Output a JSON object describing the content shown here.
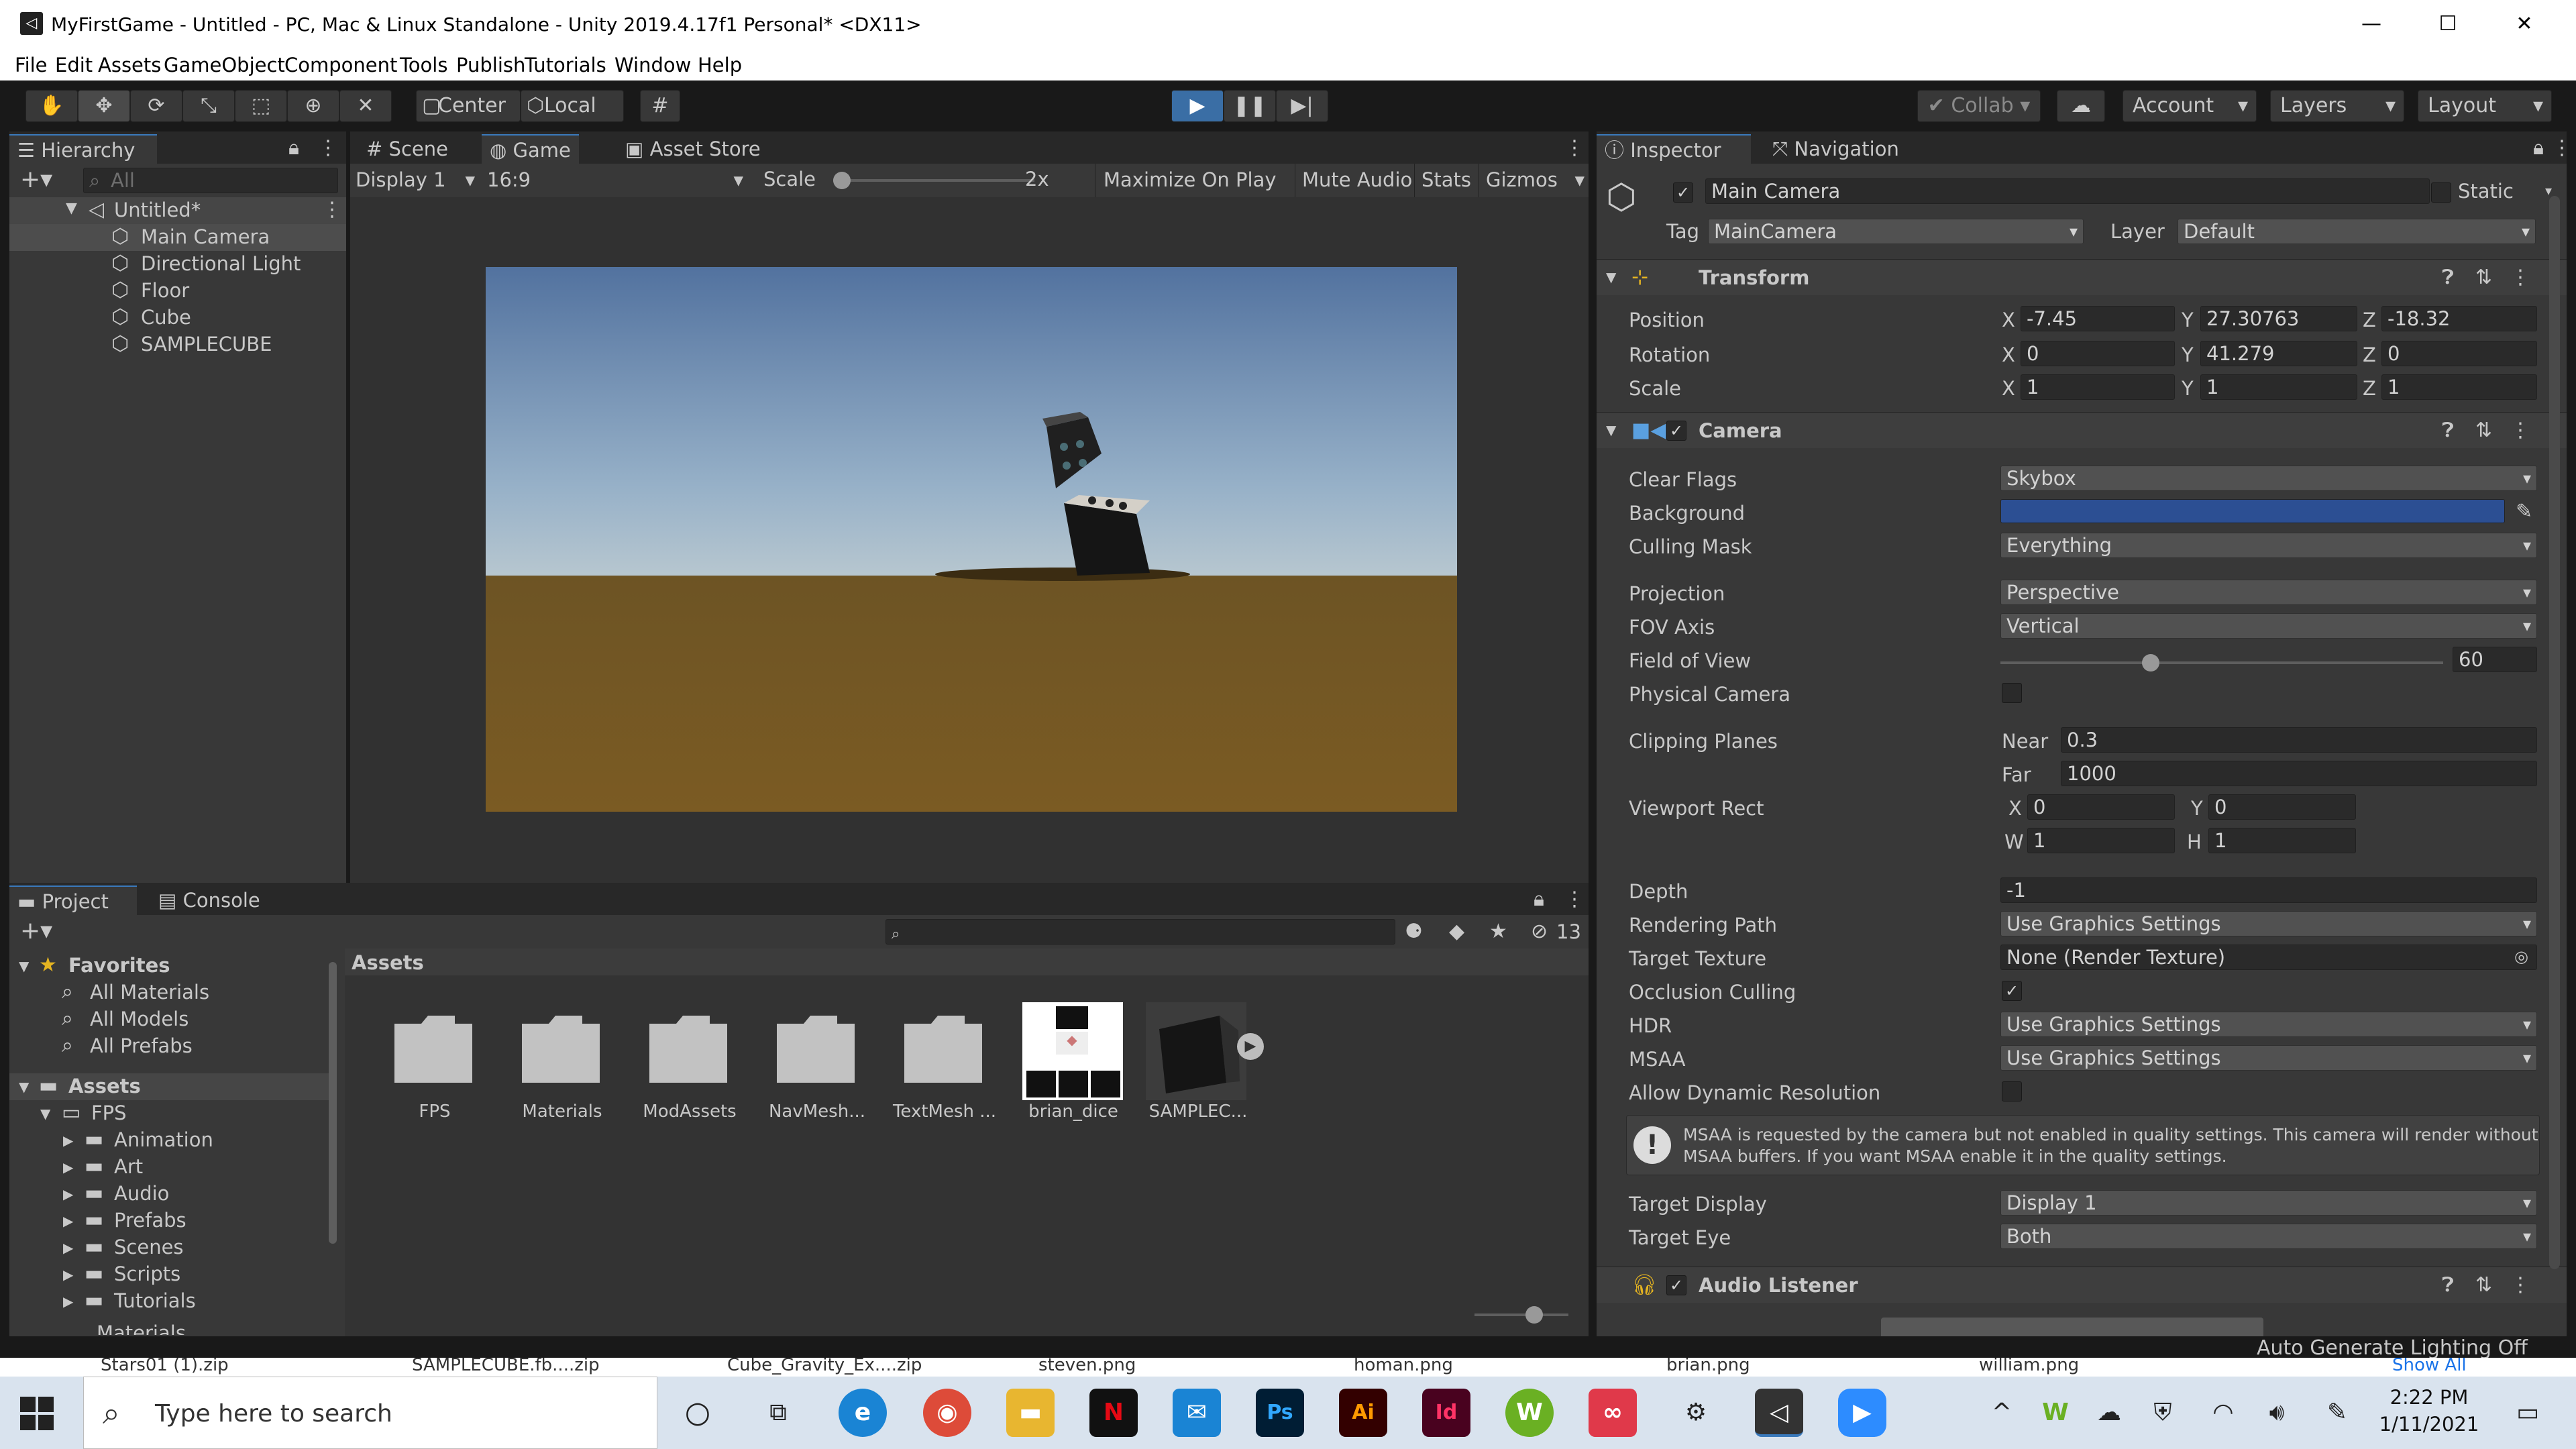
{
  "window": {
    "title": "MyFirstGame - Untitled - PC, Mac & Linux Standalone - Unity 2019.4.17f1 Personal* <DX11>"
  },
  "menu": [
    "File",
    "Edit",
    "Assets",
    "GameObject",
    "Component",
    "Tools",
    "Publish",
    "Tutorials",
    "Window",
    "Help"
  ],
  "toolbar": {
    "pivot": "Center",
    "space": "Local",
    "collab": "Collab",
    "account": "Account",
    "layers": "Layers",
    "layout": "Layout"
  },
  "hierarchy": {
    "tab": "Hierarchy",
    "search_placeholder": "All",
    "scene": "Untitled*",
    "items": [
      "Main Camera",
      "Directional Light",
      "Floor",
      "Cube",
      "SAMPLECUBE"
    ]
  },
  "center_tabs": {
    "scene": "Scene",
    "game": "Game",
    "store": "Asset Store"
  },
  "game_toolbar": {
    "display": "Display 1",
    "aspect": "16:9",
    "scale_label": "Scale",
    "scale_value": "2x",
    "scale_level": 0.0,
    "maximize": "Maximize On Play",
    "mute": "Mute Audio",
    "stats": "Stats",
    "gizmos": "Gizmos"
  },
  "project": {
    "tabs": {
      "project": "Project",
      "console": "Console"
    },
    "hidden_count": "13",
    "favorites_label": "Favorites",
    "favorites": [
      "All Materials",
      "All Models",
      "All Prefabs"
    ],
    "assets_label": "Assets",
    "fps_label": "FPS",
    "fps_children": [
      "Animation",
      "Art",
      "Audio",
      "Prefabs",
      "Scenes",
      "Scripts",
      "Tutorials"
    ],
    "more_label": "Materials",
    "breadcrumb": "Assets",
    "grid_items": [
      "FPS",
      "Materials",
      "ModAssets",
      "NavMesh...",
      "TextMesh ...",
      "brian_dice",
      "SAMPLEC..."
    ]
  },
  "inspector": {
    "tabs": {
      "inspector": "Inspector",
      "navigation": "Navigation"
    },
    "object_name": "Main Camera",
    "static_label": "Static",
    "tag_label": "Tag",
    "tag_value": "MainCamera",
    "layer_label": "Layer",
    "layer_value": "Default",
    "transform": {
      "title": "Transform",
      "position_label": "Position",
      "rotation_label": "Rotation",
      "scale_label": "Scale",
      "position": {
        "x": "-7.45",
        "y": "27.30763",
        "z": "-18.32"
      },
      "rotation": {
        "x": "0",
        "y": "41.279",
        "z": "0"
      },
      "scale": {
        "x": "1",
        "y": "1",
        "z": "1"
      }
    },
    "camera": {
      "title": "Camera",
      "clear_flags_label": "Clear Flags",
      "clear_flags": "Skybox",
      "background_label": "Background",
      "background_color": "#2c4f93",
      "culling_mask_label": "Culling Mask",
      "culling_mask": "Everything",
      "projection_label": "Projection",
      "projection": "Perspective",
      "fov_axis_label": "FOV Axis",
      "fov_axis": "Vertical",
      "fov_label": "Field of View",
      "fov": "60",
      "fov_level": 0.333,
      "physical_label": "Physical Camera",
      "clipping_label": "Clipping Planes",
      "near_label": "Near",
      "near": "0.3",
      "far_label": "Far",
      "far": "1000",
      "viewport_label": "Viewport Rect",
      "vx": "0",
      "vy": "0",
      "vw": "1",
      "vh": "1",
      "depth_label": "Depth",
      "depth": "-1",
      "rendering_path_label": "Rendering Path",
      "rendering_path": "Use Graphics Settings",
      "target_texture_label": "Target Texture",
      "target_texture": "None (Render Texture)",
      "occlusion_label": "Occlusion Culling",
      "hdr_label": "HDR",
      "hdr": "Use Graphics Settings",
      "msaa_label": "MSAA",
      "msaa": "Use Graphics Settings",
      "dynres_label": "Allow Dynamic Resolution",
      "msaa_warning_1": "MSAA is requested by the camera but not enabled in quality settings. This camera will render without",
      "msaa_warning_2": "MSAA buffers. If you want MSAA enable it in the quality settings.",
      "target_display_label": "Target Display",
      "target_display": "Display 1",
      "target_eye_label": "Target Eye",
      "target_eye": "Both"
    },
    "audio_listener": "Audio Listener"
  },
  "status": {
    "lighting": "Auto Generate Lighting Off"
  },
  "downloads": [
    "Stars01 (1).zip",
    "SAMPLECUBE.fb....zip",
    "Cube_Gravity_Ex....zip",
    "steven.png",
    "homan.png",
    "brian.png",
    "william.png",
    "Show All"
  ],
  "taskbar": {
    "search_placeholder": "Type here to search",
    "time": "2:22 PM",
    "date": "1/11/2021"
  }
}
